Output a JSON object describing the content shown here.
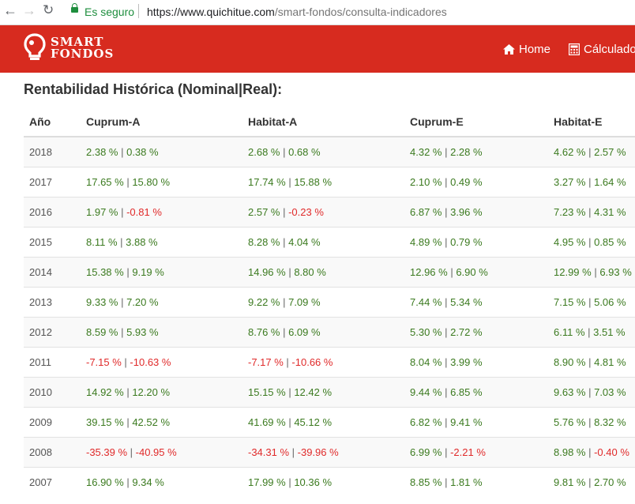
{
  "browser": {
    "secure_label": "Es seguro",
    "url_scheme_host": "https://www.quichitue.com",
    "url_path": "/smart-fondos/consulta-indicadores"
  },
  "navbar": {
    "logo_line1": "SMART",
    "logo_line2": "FONDOS",
    "items": [
      {
        "label": "Home",
        "icon": "home-icon"
      },
      {
        "label": "Cálculadora",
        "icon": "calculator-icon"
      }
    ]
  },
  "colors": {
    "brand_red": "#d72b1f",
    "positive": "#3b7a1f",
    "negative": "#e02a2a"
  },
  "heading": "Rentabilidad Histórica (Nominal|Real):",
  "table": {
    "headers": [
      "Año",
      "Cuprum-A",
      "Habitat-A",
      "Cuprum-E",
      "Habitat-E"
    ],
    "rows": [
      {
        "year": "2018",
        "cells": [
          [
            "2.38 %",
            "0.38 %"
          ],
          [
            "2.68 %",
            "0.68 %"
          ],
          [
            "4.32 %",
            "2.28 %"
          ],
          [
            "4.62 %",
            "2.57 %"
          ]
        ]
      },
      {
        "year": "2017",
        "cells": [
          [
            "17.65 %",
            "15.80 %"
          ],
          [
            "17.74 %",
            "15.88 %"
          ],
          [
            "2.10 %",
            "0.49 %"
          ],
          [
            "3.27 %",
            "1.64 %"
          ]
        ]
      },
      {
        "year": "2016",
        "cells": [
          [
            "1.97 %",
            "-0.81 %"
          ],
          [
            "2.57 %",
            "-0.23 %"
          ],
          [
            "6.87 %",
            "3.96 %"
          ],
          [
            "7.23 %",
            "4.31 %"
          ]
        ]
      },
      {
        "year": "2015",
        "cells": [
          [
            "8.11 %",
            "3.88 %"
          ],
          [
            "8.28 %",
            "4.04 %"
          ],
          [
            "4.89 %",
            "0.79 %"
          ],
          [
            "4.95 %",
            "0.85 %"
          ]
        ]
      },
      {
        "year": "2014",
        "cells": [
          [
            "15.38 %",
            "9.19 %"
          ],
          [
            "14.96 %",
            "8.80 %"
          ],
          [
            "12.96 %",
            "6.90 %"
          ],
          [
            "12.99 %",
            "6.93 %"
          ]
        ]
      },
      {
        "year": "2013",
        "cells": [
          [
            "9.33 %",
            "7.20 %"
          ],
          [
            "9.22 %",
            "7.09 %"
          ],
          [
            "7.44 %",
            "5.34 %"
          ],
          [
            "7.15 %",
            "5.06 %"
          ]
        ]
      },
      {
        "year": "2012",
        "cells": [
          [
            "8.59 %",
            "5.93 %"
          ],
          [
            "8.76 %",
            "6.09 %"
          ],
          [
            "5.30 %",
            "2.72 %"
          ],
          [
            "6.11 %",
            "3.51 %"
          ]
        ]
      },
      {
        "year": "2011",
        "cells": [
          [
            "-7.15 %",
            "-10.63 %"
          ],
          [
            "-7.17 %",
            "-10.66 %"
          ],
          [
            "8.04 %",
            "3.99 %"
          ],
          [
            "8.90 %",
            "4.81 %"
          ]
        ]
      },
      {
        "year": "2010",
        "cells": [
          [
            "14.92 %",
            "12.20 %"
          ],
          [
            "15.15 %",
            "12.42 %"
          ],
          [
            "9.44 %",
            "6.85 %"
          ],
          [
            "9.63 %",
            "7.03 %"
          ]
        ]
      },
      {
        "year": "2009",
        "cells": [
          [
            "39.15 %",
            "42.52 %"
          ],
          [
            "41.69 %",
            "45.12 %"
          ],
          [
            "6.82 %",
            "9.41 %"
          ],
          [
            "5.76 %",
            "8.32 %"
          ]
        ]
      },
      {
        "year": "2008",
        "cells": [
          [
            "-35.39 %",
            "-40.95 %"
          ],
          [
            "-34.31 %",
            "-39.96 %"
          ],
          [
            "6.99 %",
            "-2.21 %"
          ],
          [
            "8.98 %",
            "-0.40 %"
          ]
        ]
      },
      {
        "year": "2007",
        "cells": [
          [
            "16.90 %",
            "9.34 %"
          ],
          [
            "17.99 %",
            "10.36 %"
          ],
          [
            "8.85 %",
            "1.81 %"
          ],
          [
            "9.81 %",
            "2.70 %"
          ]
        ]
      }
    ]
  }
}
